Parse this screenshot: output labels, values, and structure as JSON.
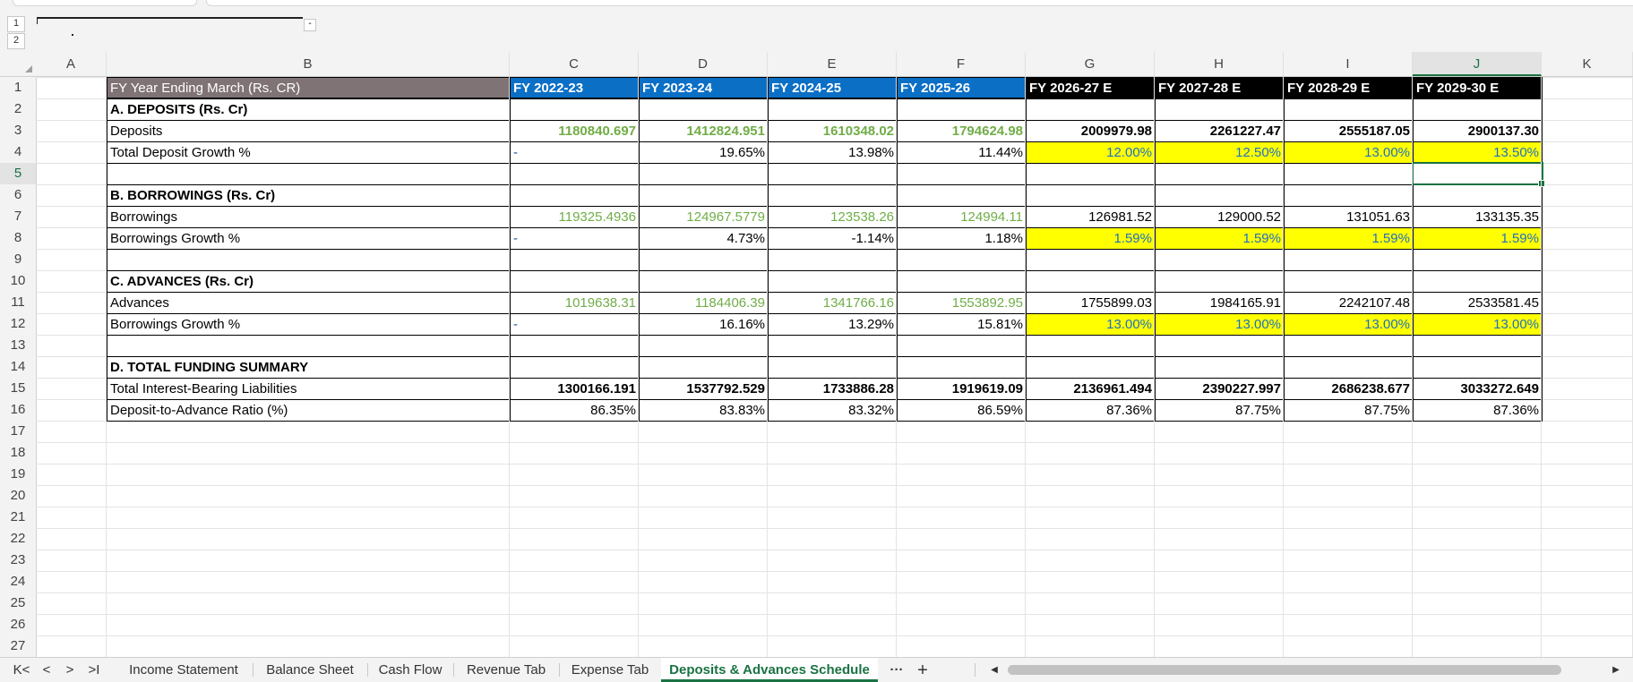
{
  "outline": {
    "levels": [
      "1",
      "2"
    ],
    "collapse_button": "-"
  },
  "columns": [
    "A",
    "B",
    "C",
    "D",
    "E",
    "F",
    "G",
    "H",
    "I",
    "J",
    "K"
  ],
  "rows": [
    "1",
    "2",
    "3",
    "4",
    "5",
    "6",
    "7",
    "8",
    "9",
    "10",
    "11",
    "12",
    "13",
    "14",
    "15",
    "16",
    "17",
    "18",
    "19",
    "20",
    "21",
    "22",
    "23",
    "24",
    "25",
    "26",
    "27"
  ],
  "selected_cell": "J5",
  "table": {
    "header": {
      "label": "FY Year Ending March (Rs. CR)",
      "years": [
        "FY 2022-23",
        "FY 2023-24",
        "FY 2024-25",
        "FY 2025-26",
        "FY 2026-27 E",
        "FY 2027-28 E",
        "FY 2028-29 E",
        "FY 2029-30 E"
      ]
    },
    "sections": {
      "deposits_title": "A. DEPOSITS (Rs. Cr)",
      "borrowings_title": "B. BORROWINGS (Rs. Cr)",
      "advances_title": "C. ADVANCES (Rs. Cr)",
      "summary_title": "D. TOTAL FUNDING SUMMARY"
    },
    "deposits": {
      "label": "Deposits",
      "values": [
        "1180840.697",
        "1412824.951",
        "1610348.02",
        "1794624.98",
        "2009979.98",
        "2261227.47",
        "2555187.05",
        "2900137.30"
      ]
    },
    "deposit_growth": {
      "label": "Total Deposit Growth %",
      "values": [
        "-",
        "19.65%",
        "13.98%",
        "11.44%",
        "12.00%",
        "12.50%",
        "13.00%",
        "13.50%"
      ]
    },
    "borrowings": {
      "label": "Borrowings",
      "values": [
        "119325.4936",
        "124967.5779",
        "123538.26",
        "124994.11",
        "126981.52",
        "129000.52",
        "131051.63",
        "133135.35"
      ]
    },
    "borrowings_growth": {
      "label": "Borrowings Growth %",
      "values": [
        "-",
        "4.73%",
        "-1.14%",
        "1.18%",
        "1.59%",
        "1.59%",
        "1.59%",
        "1.59%"
      ]
    },
    "advances": {
      "label": "Advances",
      "values": [
        "1019638.31",
        "1184406.39",
        "1341766.16",
        "1553892.95",
        "1755899.03",
        "1984165.91",
        "2242107.48",
        "2533581.45"
      ]
    },
    "advances_growth": {
      "label": "Borrowings Growth %",
      "values": [
        "-",
        "16.16%",
        "13.29%",
        "15.81%",
        "13.00%",
        "13.00%",
        "13.00%",
        "13.00%"
      ]
    },
    "total_liabilities": {
      "label": "Total Interest-Bearing Liabilities",
      "values": [
        "1300166.191",
        "1537792.529",
        "1733886.28",
        "1919619.09",
        "2136961.494",
        "2390227.997",
        "2686238.677",
        "3033272.649"
      ]
    },
    "deposit_advance_ratio": {
      "label": "Deposit-to-Advance Ratio (%)",
      "values": [
        "86.35%",
        "83.83%",
        "83.32%",
        "86.59%",
        "87.36%",
        "87.75%",
        "87.75%",
        "87.36%"
      ]
    }
  },
  "sheet_tabs": {
    "nav": [
      "K<",
      "<",
      ">",
      ">I"
    ],
    "tabs": [
      "Income Statement",
      "Balance Sheet",
      "Cash Flow",
      "Revenue Tab",
      "Expense Tab",
      "Deposits & Advances Schedule"
    ],
    "active_tab": "Deposits & Advances Schedule",
    "more": "···",
    "add": "+"
  },
  "colors": {
    "header_gray": "#7f7375",
    "header_blue": "#0b6fc6",
    "header_black": "#000000",
    "historical_green": "#70ad47",
    "assumption_yellow": "#ffff00",
    "assumption_text_blue": "#1f6fc6",
    "selection_green": "#1a7343"
  }
}
